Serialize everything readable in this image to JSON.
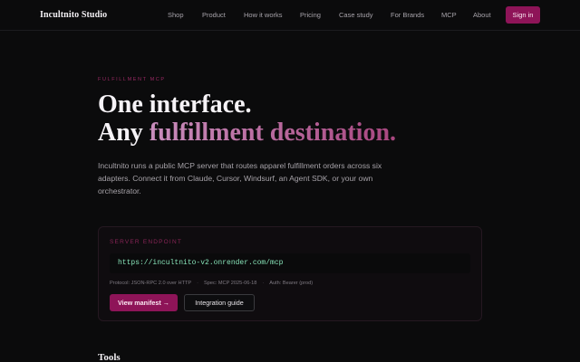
{
  "nav": {
    "brand": "Incultnito Studio",
    "links": [
      {
        "label": "Shop",
        "name": "nav-link-shop"
      },
      {
        "label": "Product",
        "name": "nav-link-product"
      },
      {
        "label": "How it works",
        "name": "nav-link-how-it-works"
      },
      {
        "label": "Pricing",
        "name": "nav-link-pricing"
      },
      {
        "label": "Case study",
        "name": "nav-link-case-study"
      },
      {
        "label": "For Brands",
        "name": "nav-link-for-brands"
      },
      {
        "label": "MCP",
        "name": "nav-link-mcp"
      },
      {
        "label": "About",
        "name": "nav-link-about"
      }
    ],
    "signin_label": "Sign in"
  },
  "hero": {
    "eyebrow": "FULFILLMENT MCP",
    "title_line1": "One interface.",
    "title_line2_prefix": "Any ",
    "title_line2_highlight": "fulfillment destination.",
    "lead": "Incultnito runs a public MCP server that routes apparel fulfillment orders across six adapters. Connect it from Claude, Cursor, Windsurf, an Agent SDK, or your own orchestrator."
  },
  "endpoint_card": {
    "label": "SERVER ENDPOINT",
    "url": "https://incultnito-v2.onrender.com/mcp",
    "protocol": "Protocol: JSON-RPC 2.0 over HTTP",
    "spec": "Spec: MCP 2025-06-18",
    "auth": "Auth: Bearer (prod)",
    "separator": "·",
    "view_manifest_label": "View manifest →",
    "integration_guide_label": "Integration guide"
  },
  "sections": {
    "tools_heading": "Tools"
  },
  "colors": {
    "accent": "#8e1458",
    "eyebrow": "#9a2a64",
    "endpoint_text": "#86e0b6",
    "background": "#0b0b0c"
  }
}
